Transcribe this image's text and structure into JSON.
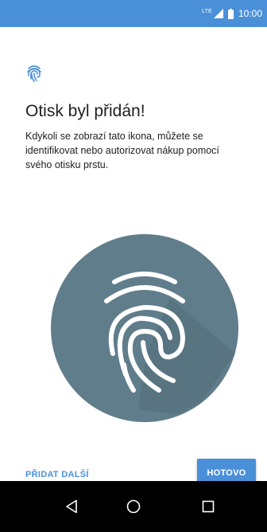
{
  "status_bar": {
    "network_label": "LTE",
    "time": "10:00"
  },
  "content": {
    "title": "Otisk byl přidán!",
    "description": "Kdykoli se zobrazí tato ikona, můžete se identifikovat nebo autorizovat nákup pomocí svého otisku prstu."
  },
  "actions": {
    "add_another_label": "PŘIDAT DALŠÍ",
    "done_label": "HOTOVO"
  },
  "nav_bar": {
    "items": [
      "back-icon",
      "home-icon",
      "recents-icon"
    ]
  },
  "colors": {
    "accent": "#4a90d9",
    "status_bar": "#4a90d9",
    "fingerprint_circle": "#607d8b",
    "nav_bar": "#000000"
  }
}
